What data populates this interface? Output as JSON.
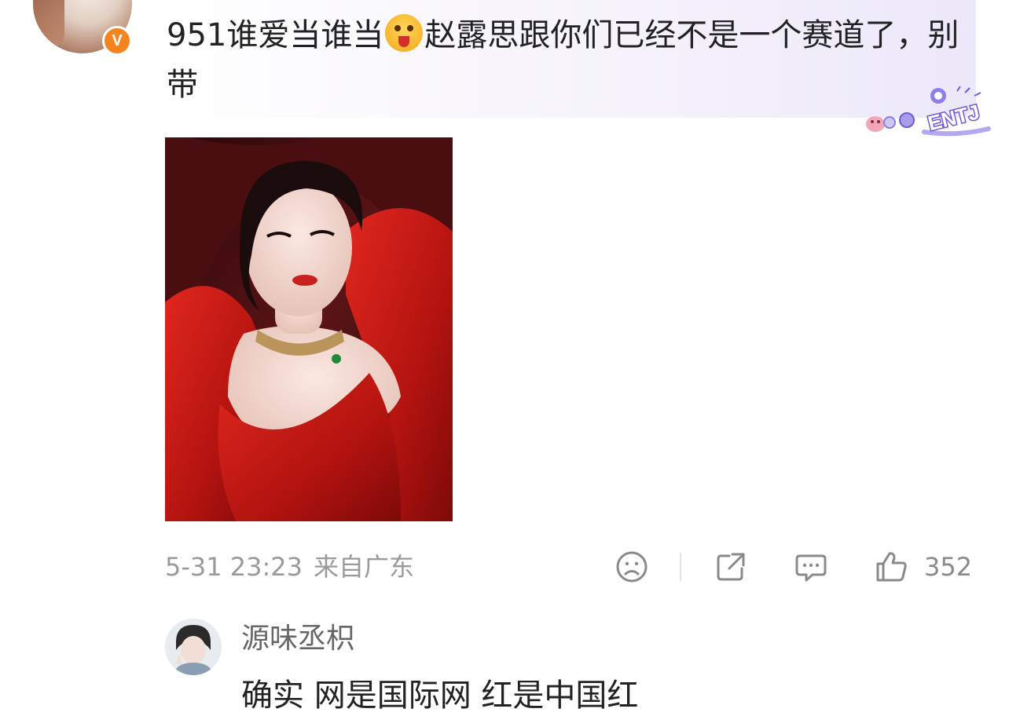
{
  "post": {
    "avatar": "user-avatar",
    "verified_badge": "V",
    "comment_part1": "951谁爱当谁当",
    "emoji": "drooling-face-emoji",
    "comment_part2": "赵露思跟你们已经不是一个赛道了，别带",
    "sticker_label": "ENTJ",
    "photo": "woman-in-red-dress-photo",
    "timestamp": "5-31 23:23",
    "location": "来自广东",
    "like_count": "352",
    "icons": {
      "dislike": "sad-face-icon",
      "share": "share-icon",
      "comment": "comment-icon",
      "like": "thumbs-up-icon"
    }
  },
  "reply": {
    "avatar": "reply-user-avatar",
    "username": "源味丞枳",
    "text": "确实 网是国际网 红是中国红"
  },
  "colors": {
    "badge": "#f5841f",
    "bubble_accent": "#ece8fa",
    "meta_gray": "#9a9a9a"
  }
}
